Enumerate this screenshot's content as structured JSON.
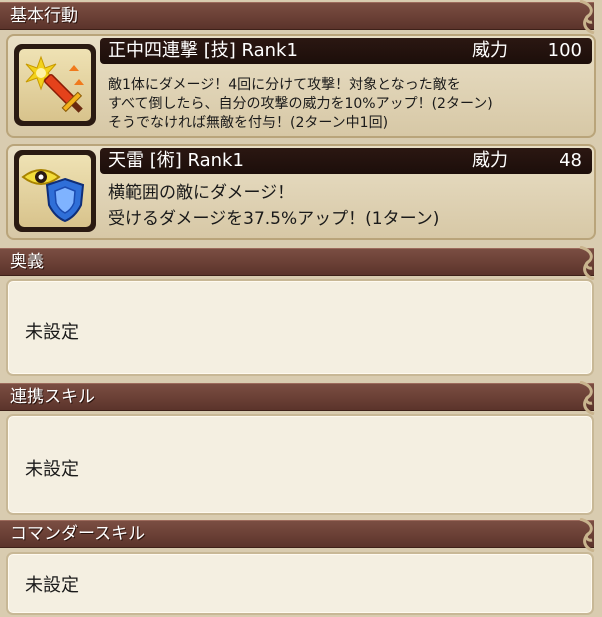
{
  "sections": {
    "basic": {
      "title": "基本行動"
    },
    "ougi": {
      "title": "奥義",
      "value": "未設定"
    },
    "link": {
      "title": "連携スキル",
      "value": "未設定"
    },
    "commander": {
      "title": "コマンダースキル",
      "value": "未設定"
    }
  },
  "skills": [
    {
      "name": "正中四連撃 [技]  Rank1",
      "power_label": "威力",
      "power_value": "100",
      "icon": "sword-burst-icon",
      "desc": [
        "敵1体にダメージ！4回に分けて攻撃！対象となった敵を",
        "すべて倒したら、自分の攻撃の威力を10%アップ！(2ターン)",
        "そうでなければ無敵を付与！(2ターン中1回)"
      ]
    },
    {
      "name": "天雷 [術]  Rank1",
      "power_label": "威力",
      "power_value": "48",
      "icon": "eye-shield-icon",
      "desc": [
        "横範囲の敵にダメージ！",
        "受けるダメージを37.5%アップ！(1ターン)"
      ]
    }
  ],
  "colors": {
    "header": "#6a3f35",
    "panel": "#f4efe1",
    "card": "#e2d6bb",
    "bar": "#231310"
  }
}
